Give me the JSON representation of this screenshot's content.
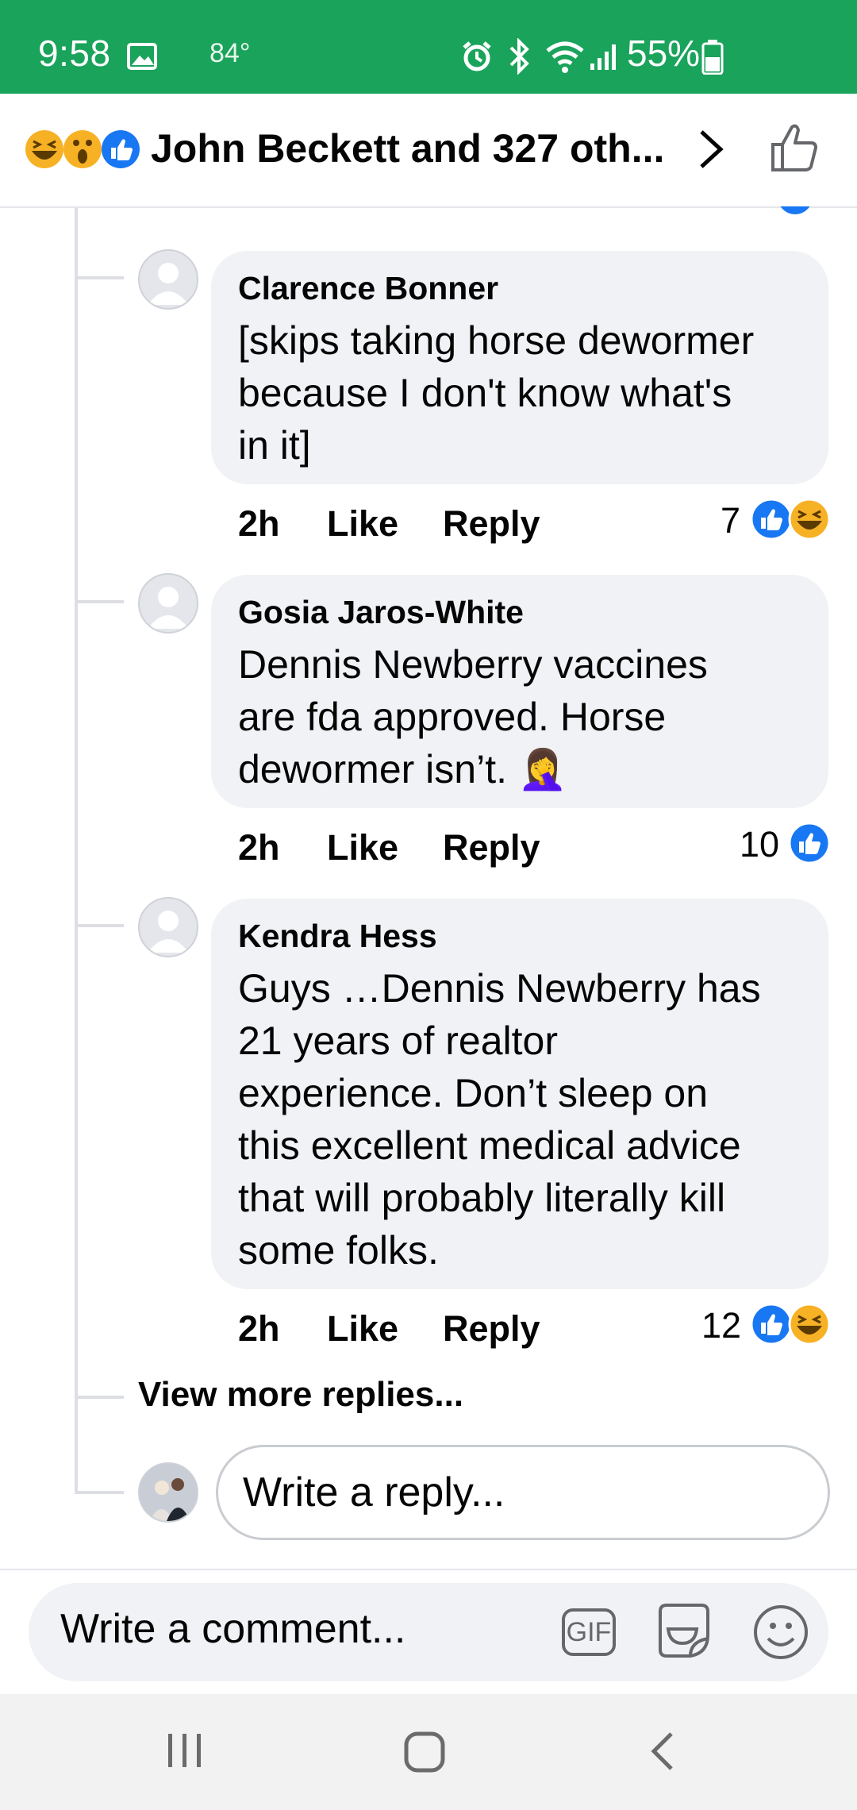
{
  "status": {
    "time": "9:58",
    "temperature": "84°",
    "battery": "55%",
    "bg_color": "#1aa35b"
  },
  "header": {
    "title": "John Beckett and 327 oth...",
    "reactions": [
      "laughing-emoji",
      "surprised-emoji",
      "like-icon"
    ]
  },
  "comments": [
    {
      "author": "Clarence Bonner",
      "lines": [
        "[skips taking horse dewormer",
        "because I don't know what's",
        "in it]"
      ],
      "time": "2h",
      "like_label": "Like",
      "reply_label": "Reply",
      "reaction_count": "7",
      "reactions": [
        "like",
        "haha"
      ]
    },
    {
      "author": "Gosia Jaros-White",
      "lines": [
        "Dennis Newberry vaccines",
        "are fda approved. Horse",
        "dewormer isn’t. 🤦‍♀️"
      ],
      "time": "2h",
      "like_label": "Like",
      "reply_label": "Reply",
      "reaction_count": "10",
      "reactions": [
        "like"
      ]
    },
    {
      "author": "Kendra Hess",
      "lines": [
        "Guys …Dennis Newberry has",
        "21 years of realtor",
        "experience. Don’t sleep on",
        "this excellent medical advice",
        "that will probably literally kill",
        "some folks."
      ],
      "time": "2h",
      "like_label": "Like",
      "reply_label": "Reply",
      "reaction_count": "12",
      "reactions": [
        "like",
        "haha"
      ]
    }
  ],
  "view_more": "View more replies...",
  "reply_placeholder": "Write a reply...",
  "comment_placeholder": "Write a comment...",
  "gif_label": "GIF",
  "colors": {
    "like_blue": "#1877f2",
    "accent_green": "#1aa35b"
  }
}
